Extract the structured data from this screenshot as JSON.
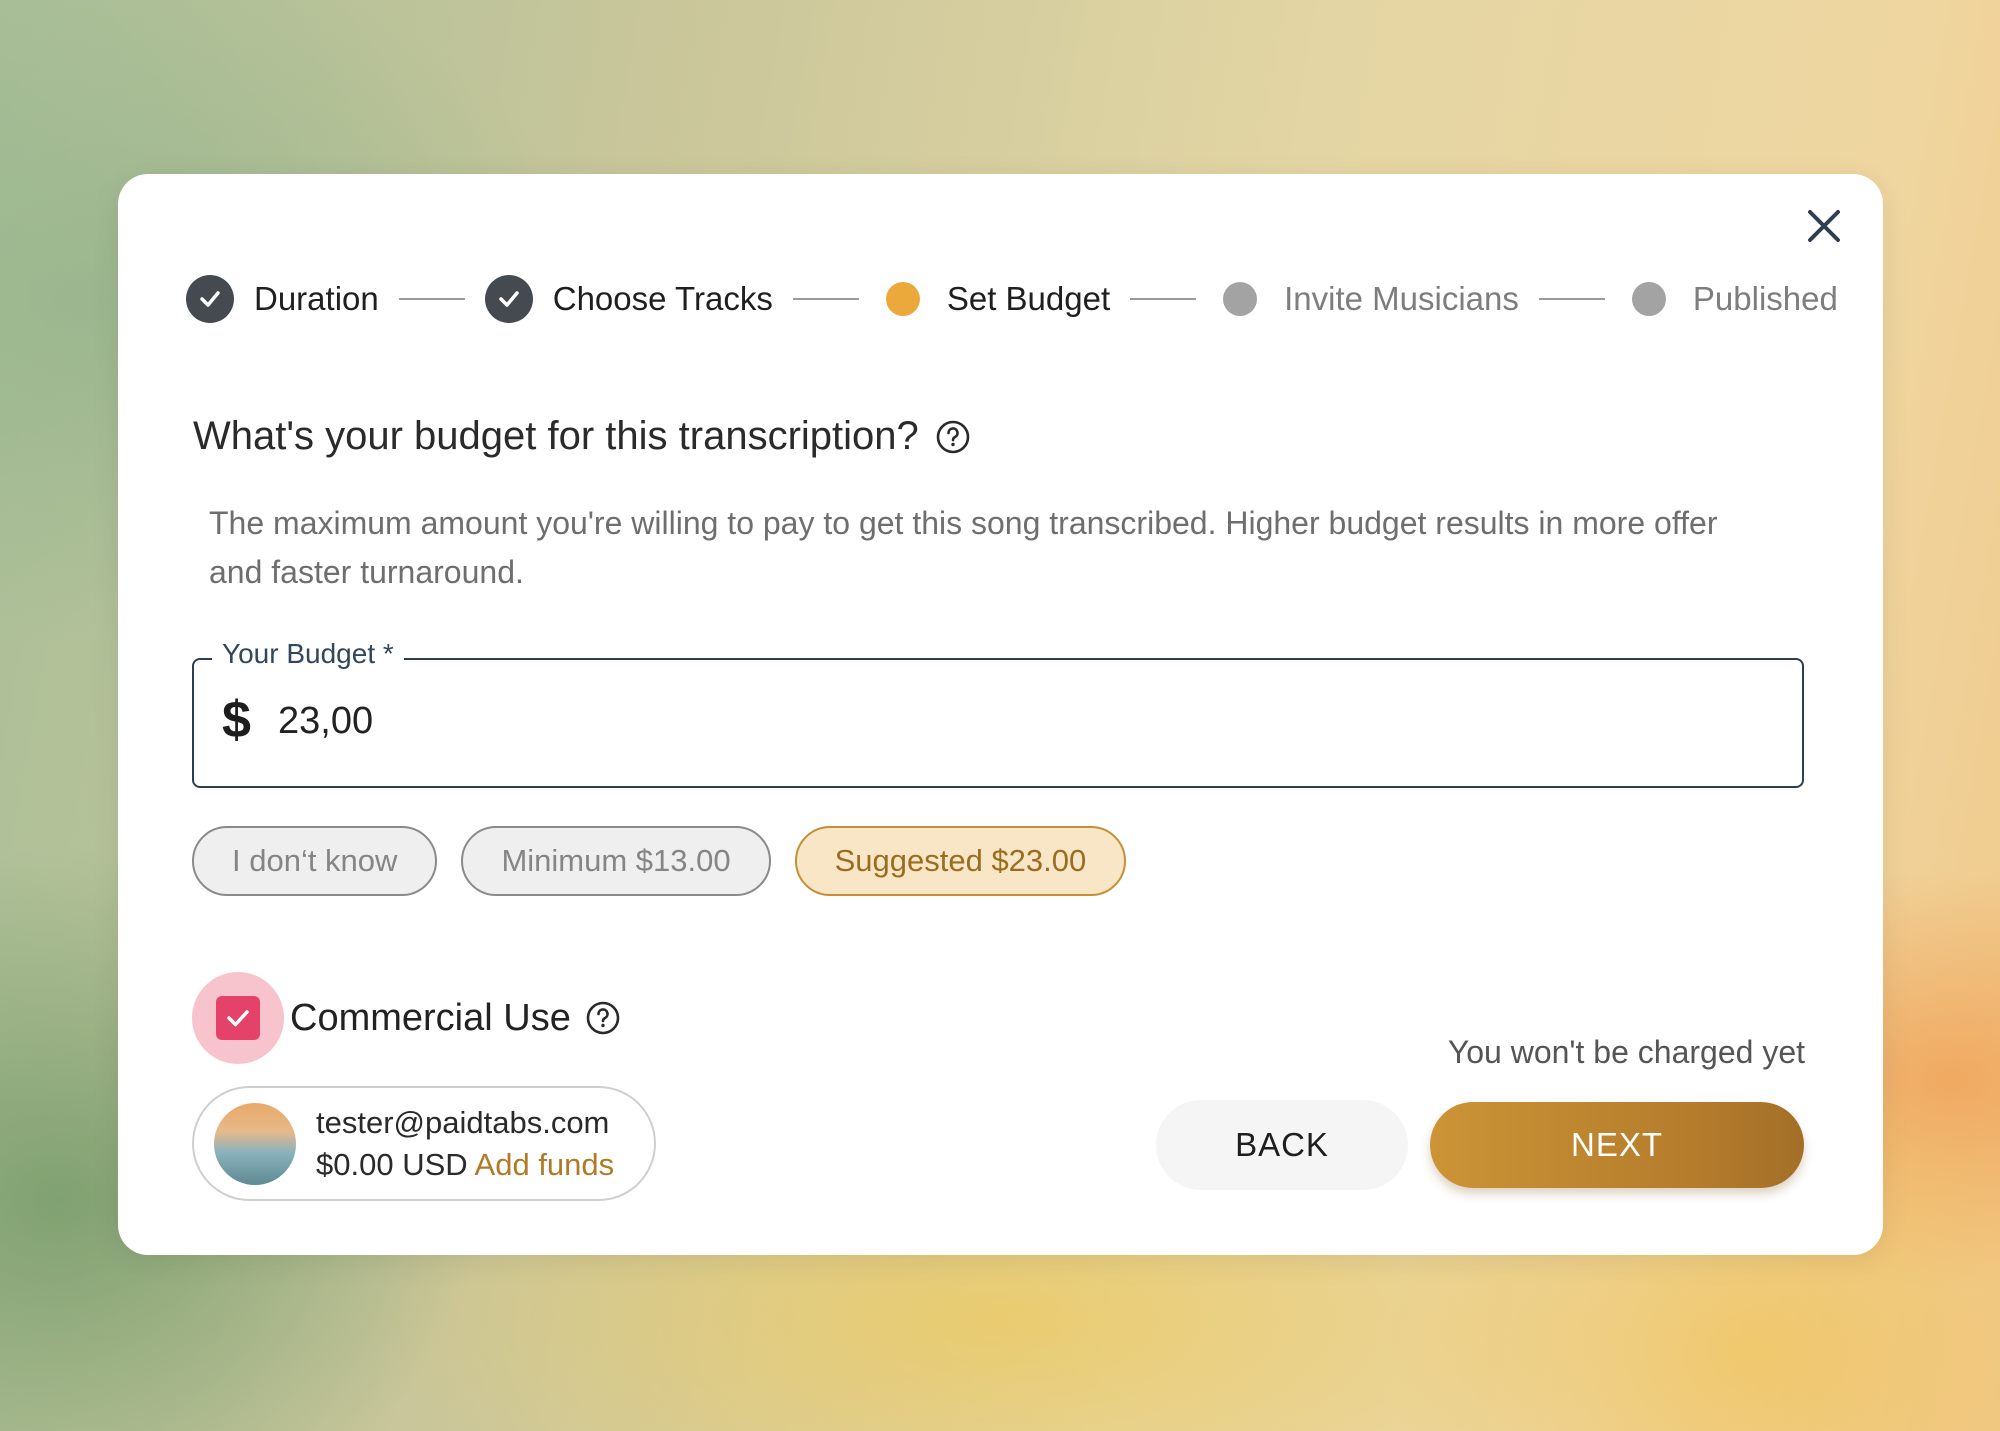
{
  "steps": [
    {
      "label": "Duration",
      "state": "done"
    },
    {
      "label": "Choose Tracks",
      "state": "done"
    },
    {
      "label": "Set Budget",
      "state": "active"
    },
    {
      "label": "Invite Musicians",
      "state": "pending"
    },
    {
      "label": "Published",
      "state": "pending"
    }
  ],
  "question": {
    "title": "What's your budget for this transcription?",
    "help_icon": "help-circle-icon"
  },
  "description": "The maximum amount you're willing to pay to get this song transcribed. Higher budget results in more offer and faster turnaround.",
  "budget_field": {
    "label": "Your Budget",
    "required_mark": "*",
    "currency_symbol": "$",
    "value": "23,00"
  },
  "chips": {
    "dont_know": "I don‘t know",
    "minimum": "Minimum $13.00",
    "suggested": "Suggested $23.00"
  },
  "commercial_use": {
    "label": "Commercial Use",
    "checked": true
  },
  "account": {
    "email": "tester@paidtabs.com",
    "balance": "$0.00 USD",
    "add_funds": "Add funds"
  },
  "charge_note": "You won't be charged yet",
  "buttons": {
    "back": "BACK",
    "next": "NEXT"
  },
  "colors": {
    "accent": "#eba93b",
    "next_button": "#c28a33",
    "checkbox": "#e5426a",
    "done_step": "#454a50",
    "pending_step": "#a3a3a3"
  }
}
